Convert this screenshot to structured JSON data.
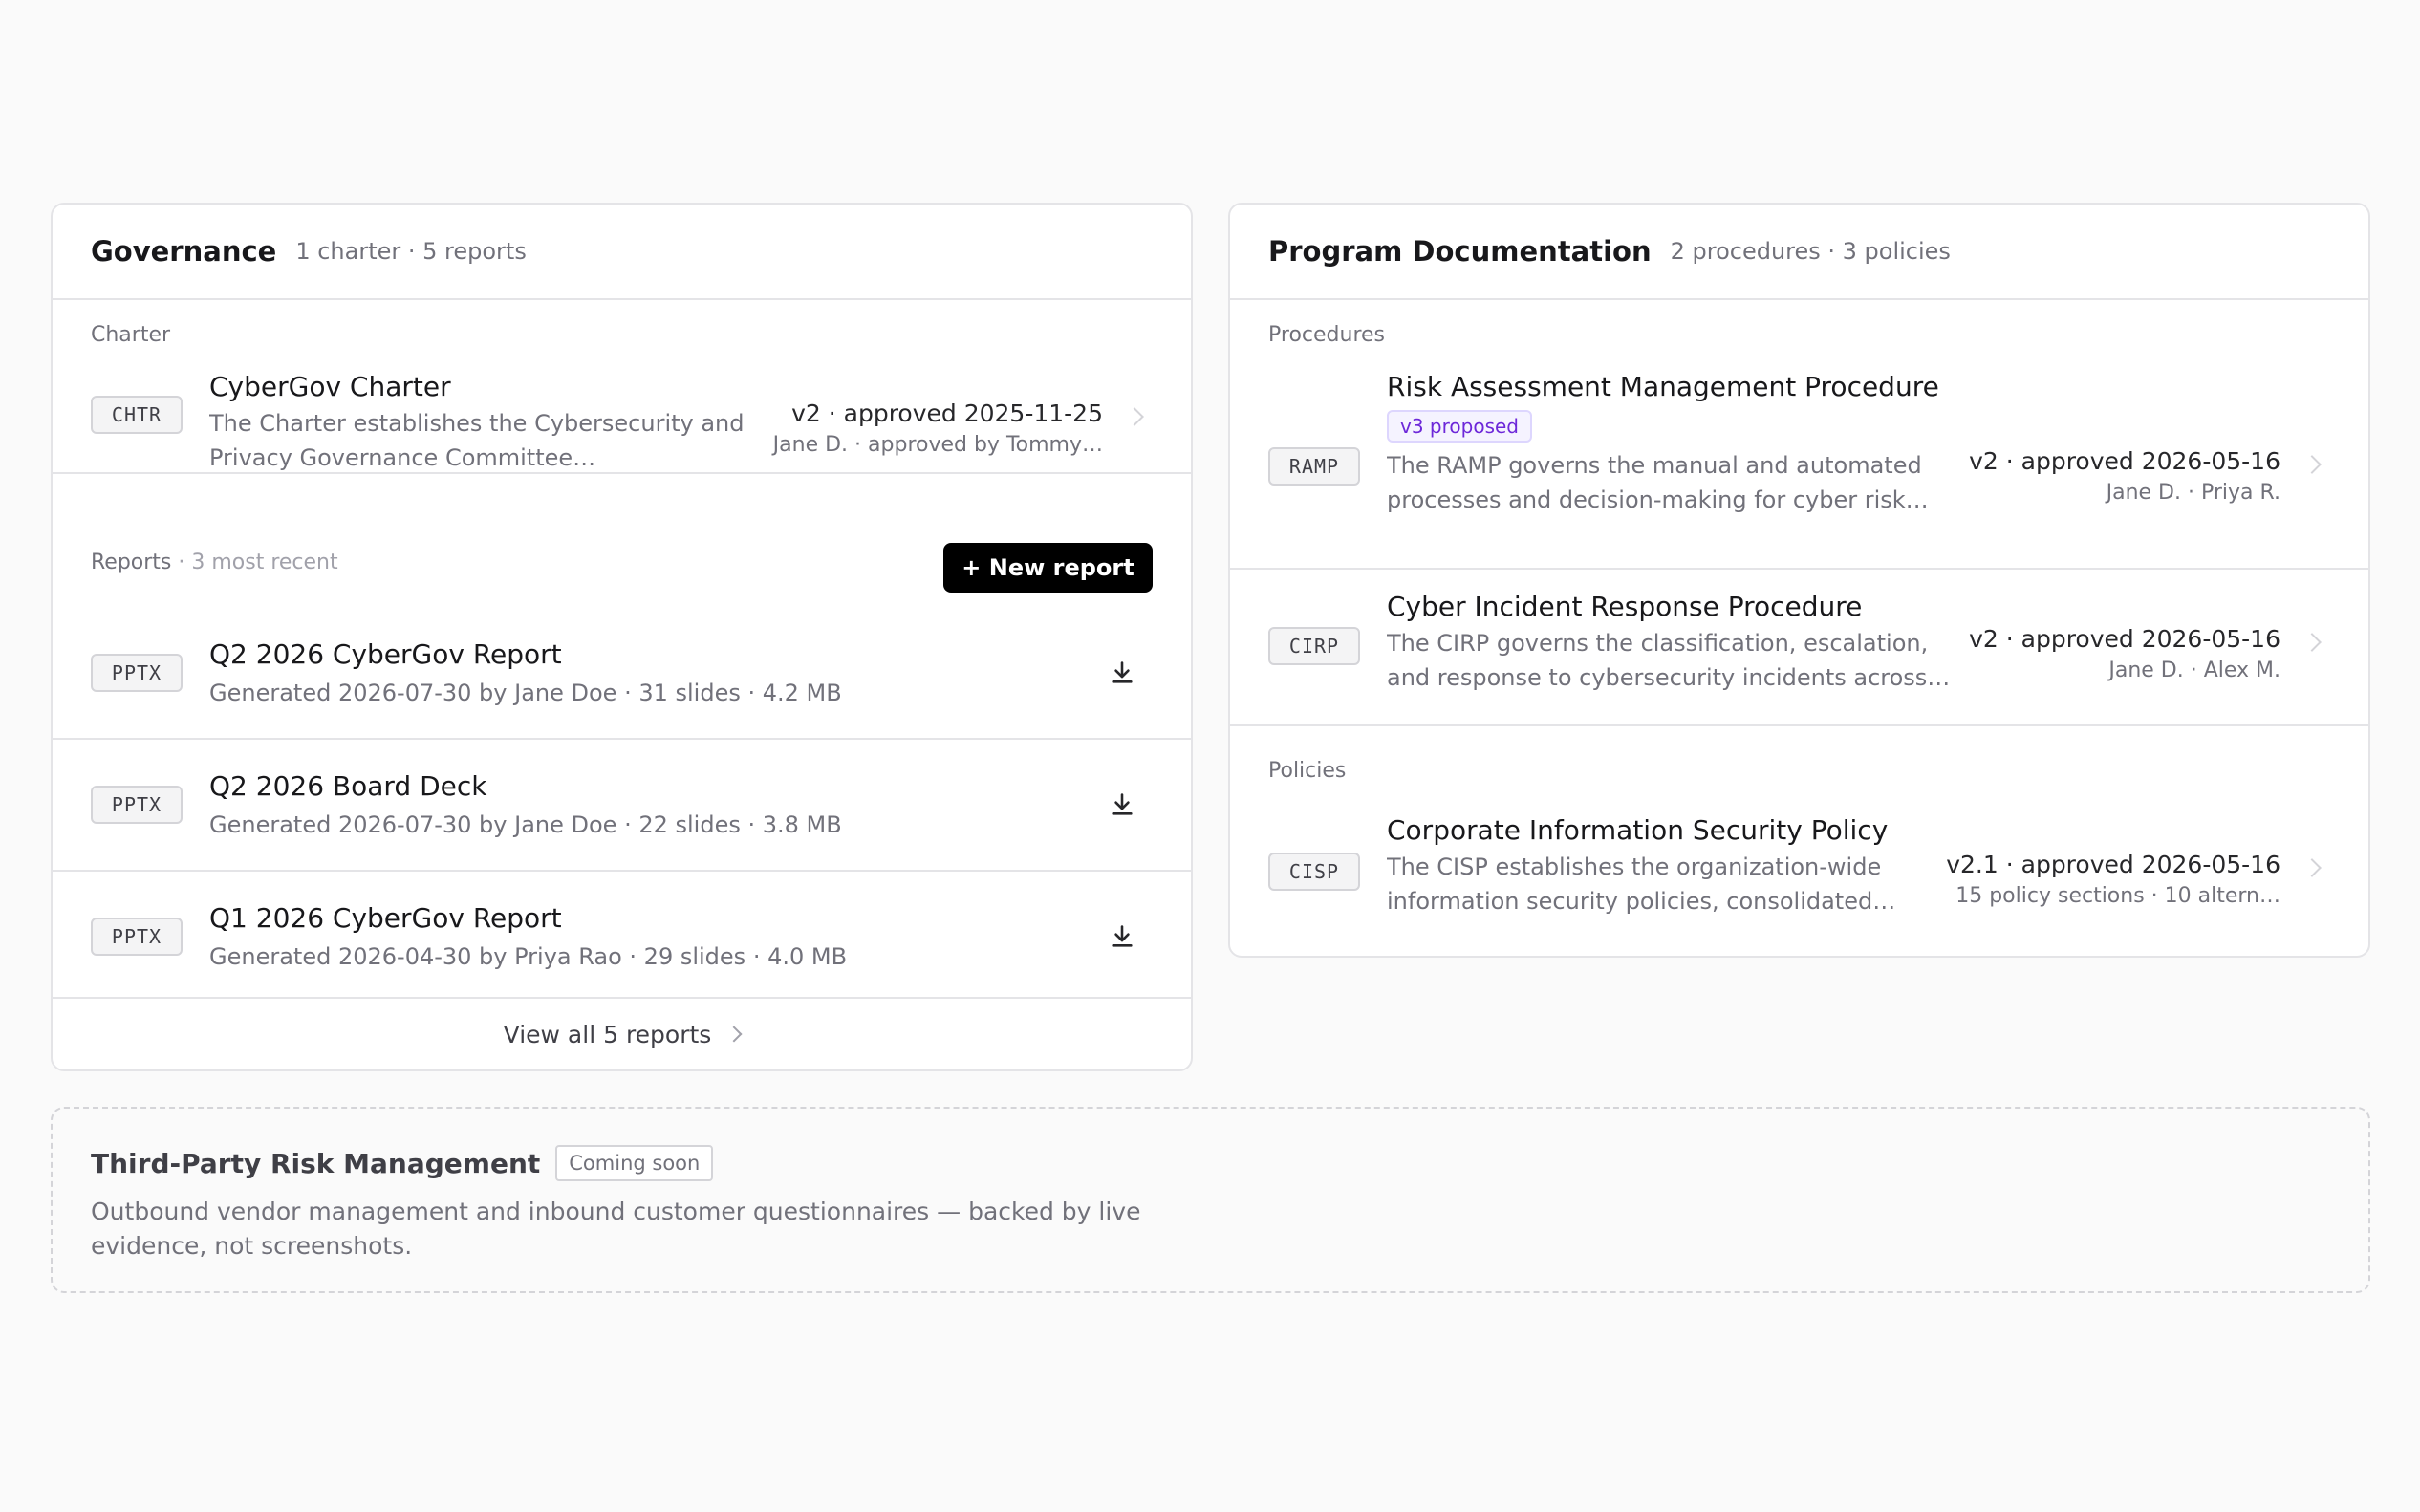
{
  "governance": {
    "title": "Governance",
    "subtitle": "1 charter · 5 reports",
    "charter_label": "Charter",
    "charter": {
      "code": "CHTR",
      "title": "CyberGov Charter",
      "description": "The Charter establishes the Cybersecurity and Privacy Governance Committee…",
      "version": "v2 · approved 2025-11-25",
      "approvers": "Jane D. · approved by Tommy…"
    },
    "reports_label": "Reports",
    "reports_sub": " · 3 most recent",
    "new_report_label": "+ New report",
    "reports": [
      {
        "code": "PPTX",
        "title": "Q2 2026 CyberGov Report",
        "meta": "Generated 2026-07-30 by Jane Doe · 31 slides · 4.2 MB"
      },
      {
        "code": "PPTX",
        "title": "Q2 2026 Board Deck",
        "meta": "Generated 2026-07-30 by Jane Doe · 22 slides · 3.8 MB"
      },
      {
        "code": "PPTX",
        "title": "Q1 2026 CyberGov Report",
        "meta": "Generated 2026-04-30 by Priya Rao · 29 slides · 4.0 MB"
      }
    ],
    "view_all_label": "View all 5 reports"
  },
  "program": {
    "title": "Program Documentation",
    "subtitle": "2 procedures · 3 policies",
    "procedures_label": "Procedures",
    "procedures": [
      {
        "code": "RAMP",
        "title": "Risk Assessment Management Procedure",
        "badge": "v3 proposed",
        "description": "The RAMP governs the manual and automated processes and decision-making for cyber risk…",
        "version": "v2 · approved 2026-05-16",
        "approvers": "Jane D. · Priya R."
      },
      {
        "code": "CIRP",
        "title": "Cyber Incident Response Procedure",
        "description": "The CIRP governs the classification, escalation, and response to cybersecurity incidents across…",
        "version": "v2 · approved 2026-05-16",
        "approvers": "Jane D. · Alex M."
      }
    ],
    "policies_label": "Policies",
    "policies": [
      {
        "code": "CISP",
        "title": "Corporate Information Security Policy",
        "description": "The CISP establishes the organization-wide information security policies, consolidated…",
        "version": "v2.1 · approved 2026-05-16",
        "approvers": "15 policy sections · 10 altern…"
      }
    ]
  },
  "tprm": {
    "title": "Third-Party Risk Management",
    "badge": "Coming soon",
    "description": "Outbound vendor management and inbound customer questionnaires — backed by live evidence, not screenshots."
  },
  "icons": {
    "download": "download-icon",
    "chevron": "chevron-right-icon"
  },
  "colors": {
    "accent": "#000000",
    "proposed_text": "#6d28d9",
    "proposed_bg": "#f5f3ff"
  }
}
